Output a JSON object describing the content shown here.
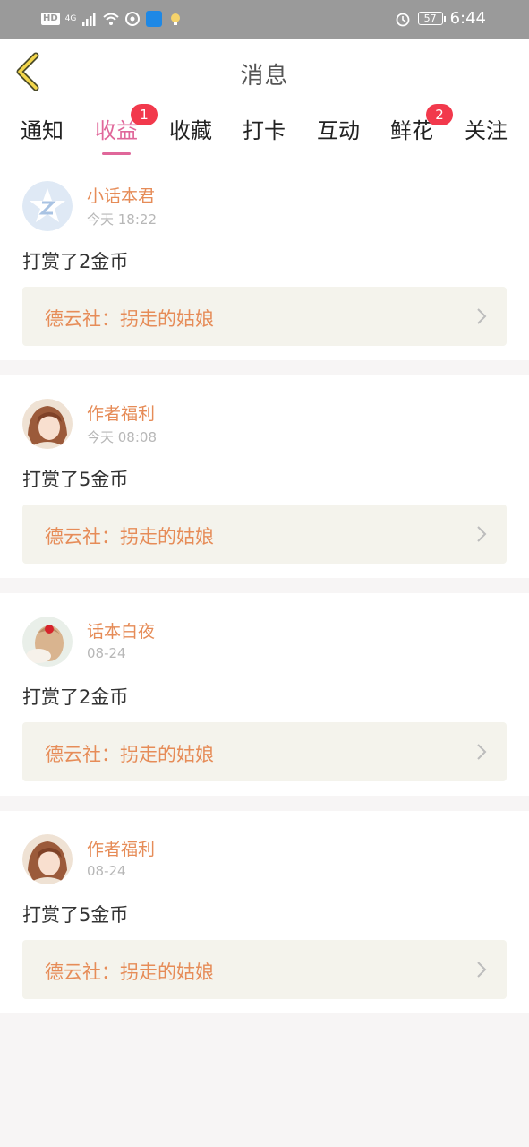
{
  "status_bar": {
    "hd": "HD",
    "signal": "4G",
    "battery": "57",
    "time": "6:44"
  },
  "header": {
    "title": "消息",
    "back_icon": "back-chevron-icon"
  },
  "tabs": [
    {
      "label": "通知",
      "badge": ""
    },
    {
      "label": "收益",
      "badge": "1",
      "active": true
    },
    {
      "label": "收藏",
      "badge": ""
    },
    {
      "label": "打卡",
      "badge": ""
    },
    {
      "label": "互动",
      "badge": ""
    },
    {
      "label": "鲜花",
      "badge": "2"
    },
    {
      "label": "关注",
      "badge": ""
    }
  ],
  "messages": [
    {
      "user": "小话本君",
      "time": "今天 18:22",
      "text": "打赏了2金币",
      "link": "德云社：拐走的姑娘",
      "avatar": "star-logo"
    },
    {
      "user": "作者福利",
      "time": "今天 08:08",
      "text": "打赏了5金币",
      "link": "德云社：拐走的姑娘",
      "avatar": "anime-girl"
    },
    {
      "user": "话本白夜",
      "time": "08-24",
      "text": "打赏了2金币",
      "link": "德云社：拐走的姑娘",
      "avatar": "hair-bow-girl"
    },
    {
      "user": "作者福利",
      "time": "08-24",
      "text": "打赏了5金币",
      "link": "德云社：拐走的姑娘",
      "avatar": "anime-girl"
    }
  ],
  "colors": {
    "accent": "#e0679a",
    "username": "#e68c58",
    "badge": "#f2394c",
    "link_bg": "#f4f3ec"
  }
}
